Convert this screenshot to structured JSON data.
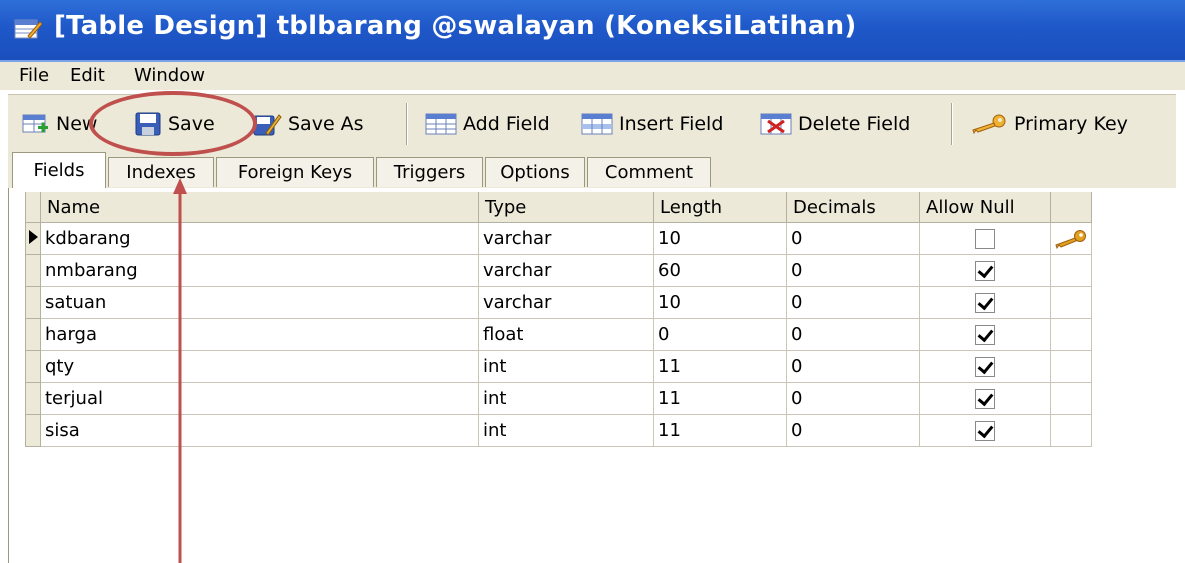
{
  "window": {
    "title": "[Table Design] tblbarang @swalayan (KoneksiLatihan)"
  },
  "menu": [
    {
      "label": "File"
    },
    {
      "label": "Edit"
    },
    {
      "label": "Window"
    }
  ],
  "toolbar": {
    "new_label": "New",
    "save_label": "Save",
    "save_as_label": "Save As",
    "add_field_label": "Add Field",
    "insert_field_label": "Insert Field",
    "delete_field_label": "Delete Field",
    "primary_key_label": "Primary Key"
  },
  "tabs": [
    {
      "label": "Fields",
      "active": true
    },
    {
      "label": "Indexes"
    },
    {
      "label": "Foreign Keys"
    },
    {
      "label": "Triggers"
    },
    {
      "label": "Options"
    },
    {
      "label": "Comment"
    }
  ],
  "grid": {
    "columns": [
      "Name",
      "Type",
      "Length",
      "Decimals",
      "Allow Null"
    ],
    "rows": [
      {
        "name": "kdbarang",
        "type": "varchar",
        "length": "10",
        "decimals": "0",
        "allow_null": false,
        "primary_key": true,
        "current": true
      },
      {
        "name": "nmbarang",
        "type": "varchar",
        "length": "60",
        "decimals": "0",
        "allow_null": true
      },
      {
        "name": "satuan",
        "type": "varchar",
        "length": "10",
        "decimals": "0",
        "allow_null": true
      },
      {
        "name": "harga",
        "type": "float",
        "length": "0",
        "decimals": "0",
        "allow_null": true
      },
      {
        "name": "qty",
        "type": "int",
        "length": "11",
        "decimals": "0",
        "allow_null": true
      },
      {
        "name": "terjual",
        "type": "int",
        "length": "11",
        "decimals": "0",
        "allow_null": true
      },
      {
        "name": "sisa",
        "type": "int",
        "length": "11",
        "decimals": "0",
        "allow_null": true
      }
    ]
  },
  "icons": {
    "title": "table-design-icon",
    "new": "new-table-icon",
    "save": "floppy-disk-icon",
    "save_as": "save-as-icon",
    "add_field": "add-field-icon",
    "insert_field": "insert-field-icon",
    "delete_field": "delete-field-icon",
    "primary_key": "key-icon"
  },
  "colors": {
    "titlebar": "#1f58c9",
    "chrome": "#ece9d8",
    "annotation": "#c0504d",
    "key": "#e0a020"
  }
}
